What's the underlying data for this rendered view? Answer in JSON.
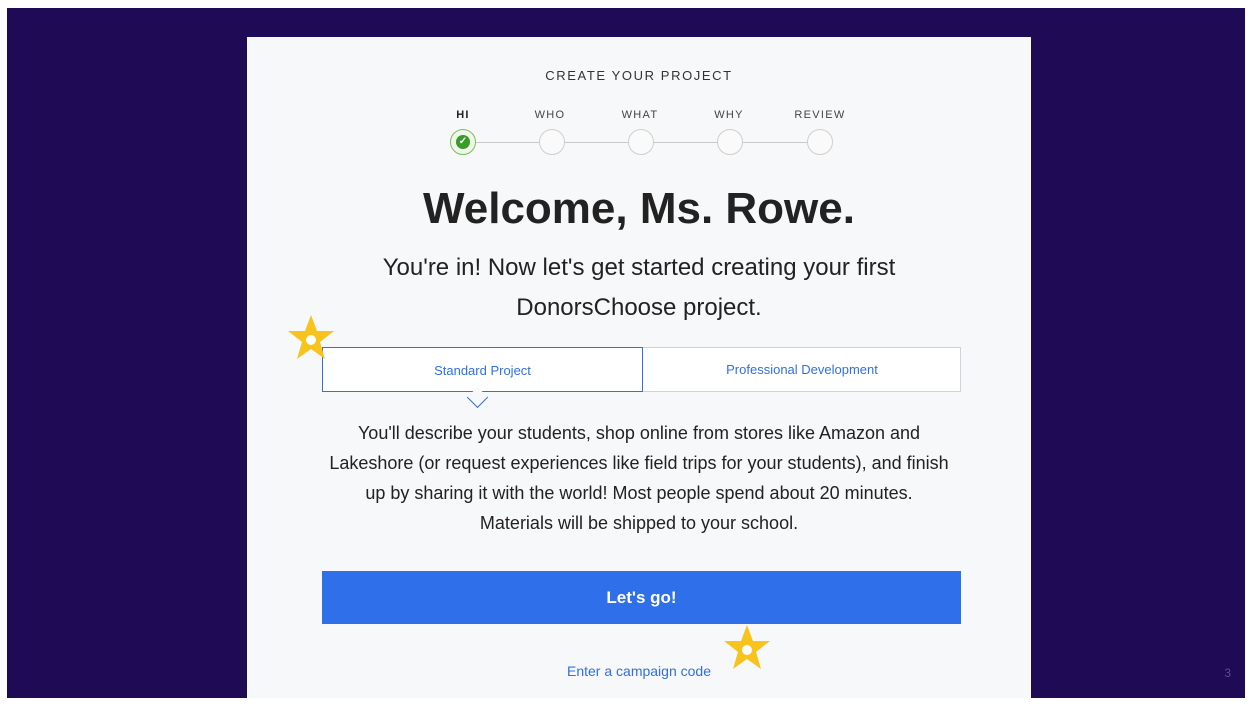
{
  "header": {
    "title": "CREATE YOUR PROJECT"
  },
  "steps": [
    {
      "label": "HI",
      "state": "done"
    },
    {
      "label": "WHO",
      "state": "pending"
    },
    {
      "label": "WHAT",
      "state": "pending"
    },
    {
      "label": "WHY",
      "state": "pending"
    },
    {
      "label": "REVIEW",
      "state": "pending"
    }
  ],
  "welcome": {
    "title": "Welcome, Ms. Rowe.",
    "subtitle": "You're in! Now let's get started creating your first DonorsChoose project."
  },
  "tabs": [
    {
      "label": "Standard Project",
      "active": true
    },
    {
      "label": "Professional Development",
      "active": false
    }
  ],
  "description": "You'll describe your students, shop online from stores like Amazon and Lakeshore (or request experiences like field trips for your students), and finish up by sharing it with the world! Most people spend about 20 minutes. Materials will be shipped to your school.",
  "cta": {
    "label": "Let's go!"
  },
  "campaign_link": {
    "label": "Enter a campaign code"
  },
  "slide": {
    "page_number": "3"
  },
  "colors": {
    "slide_background": "#1e0a55",
    "accent_blue": "#2f6fe9",
    "check_green": "#3a9a2a",
    "star_yellow": "#f7c31c"
  },
  "icons": {
    "check": "checkmark-icon",
    "star": "star-icon"
  }
}
